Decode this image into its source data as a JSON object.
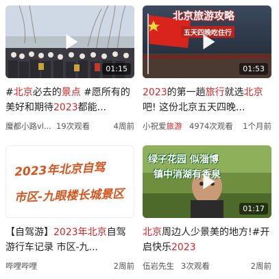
{
  "videos": [
    {
      "title_parts": [
        {
          "text": "#",
          "hl": false
        },
        {
          "text": "北京",
          "hl": true
        },
        {
          "text": "必去的",
          "hl": false
        },
        {
          "text": "景点",
          "hl": true
        },
        {
          "text": " #愿所有的美好和期待",
          "hl": false
        },
        {
          "text": "2023",
          "hl": true
        },
        {
          "text": "都能...",
          "hl": false
        }
      ],
      "duration": "01:15",
      "author": "魔都小路vl...",
      "views": "19次观看",
      "ago": "4周前"
    },
    {
      "banner_top": "北京旅游攻略",
      "banner_sub": "五天四晚吃住行",
      "title_parts": [
        {
          "text": "2023",
          "hl": true
        },
        {
          "text": "的第一趟",
          "hl": false
        },
        {
          "text": "旅行",
          "hl": true
        },
        {
          "text": "就选",
          "hl": false
        },
        {
          "text": "北京",
          "hl": true
        },
        {
          "text": "吧! 这份北京五天四晚...",
          "hl": false
        }
      ],
      "duration": "01:53",
      "author_parts": [
        {
          "text": "小祝爱",
          "hl": false
        },
        {
          "text": "旅游",
          "hl": true
        }
      ],
      "views": "4974次观看",
      "ago": "1个月前"
    },
    {
      "banner_line1": "2023年北京自驾",
      "banner_line2": "市区-九眼楼长城景区",
      "title_parts": [
        {
          "text": "【自驾游】",
          "hl": false
        },
        {
          "text": "2023年北京",
          "hl": true
        },
        {
          "text": "自驾游行车记录 市区-九...",
          "hl": false
        }
      ],
      "author": "哔哩哔哩",
      "ago": "2周前"
    },
    {
      "banner_line1": "绿子花园 似淄博",
      "banner_line2": "镇中消湖有香泉",
      "title_parts": [
        {
          "text": "北京",
          "hl": true
        },
        {
          "text": "周边人少景美的地方!#开启快乐",
          "hl": false
        },
        {
          "text": "2023",
          "hl": true
        }
      ],
      "duration": "01:17",
      "author": "伍岩先生",
      "views": "3次观看",
      "ago": "2周前"
    }
  ]
}
